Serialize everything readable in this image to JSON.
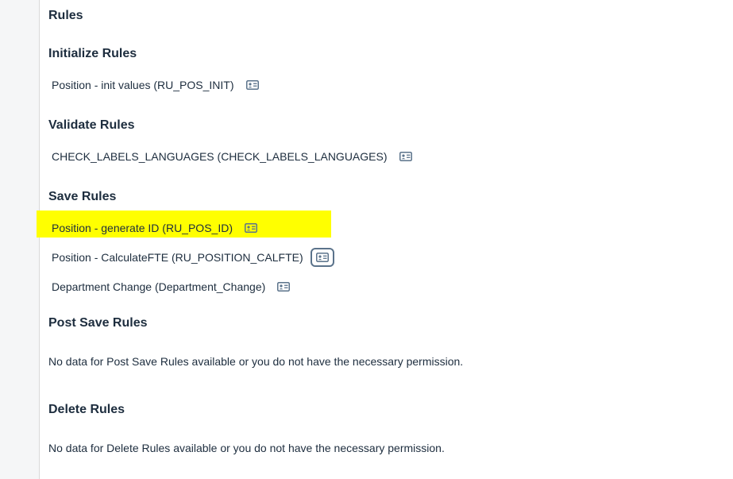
{
  "page_title": "Rules",
  "sections": {
    "initialize": {
      "title": "Initialize Rules",
      "items": [
        {
          "label": "Position - init values (RU_POS_INIT)",
          "icon": "business-card-icon"
        }
      ]
    },
    "validate": {
      "title": "Validate Rules",
      "items": [
        {
          "label": "CHECK_LABELS_LANGUAGES (CHECK_LABELS_LANGUAGES)",
          "icon": "business-card-icon"
        }
      ]
    },
    "save": {
      "title": "Save Rules",
      "items": [
        {
          "label": "Position - generate ID (RU_POS_ID)",
          "icon": "business-card-icon",
          "highlighted": true,
          "highlight_color": "#ffff00"
        },
        {
          "label": "Position - CalculateFTE (RU_POSITION_CALFTE)",
          "icon": "business-card-icon",
          "focused": true
        },
        {
          "label": "Department Change (Department_Change)",
          "icon": "business-card-icon"
        }
      ]
    },
    "post_save": {
      "title": "Post Save Rules",
      "empty_message": "No data for Post Save Rules available or you do not have the necessary permission."
    },
    "delete": {
      "title": "Delete Rules",
      "empty_message": "No data for Delete Rules available or you do not have the necessary permission."
    }
  },
  "colors": {
    "text": "#1d2d3e",
    "icon": "#5b738b",
    "rail": "#f5f6f7"
  }
}
